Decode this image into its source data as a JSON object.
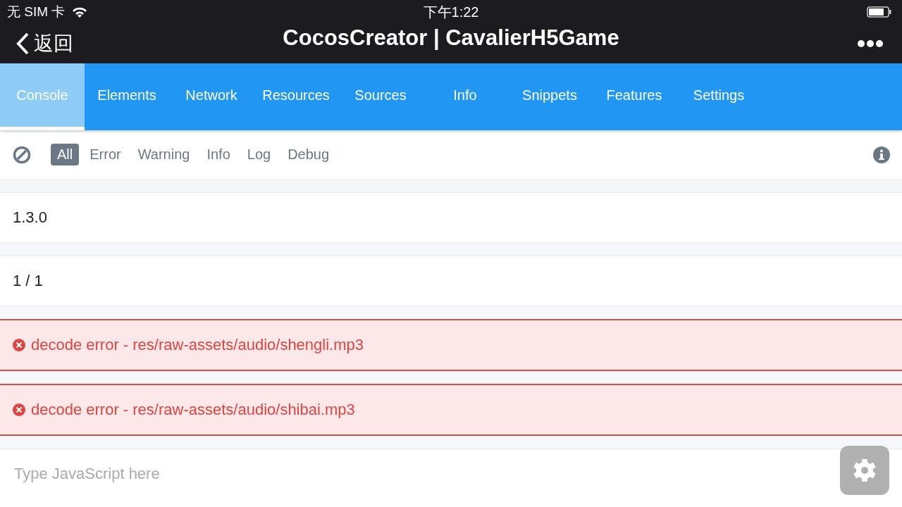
{
  "status_bar": {
    "carrier": "无 SIM 卡",
    "time": "下午1:22"
  },
  "nav": {
    "back": "返回",
    "title": "CocosCreator | CavalierH5Game"
  },
  "tabs": [
    {
      "label": "Console",
      "selected": true
    },
    {
      "label": "Elements",
      "selected": false
    },
    {
      "label": "Network",
      "selected": false
    },
    {
      "label": "Resources",
      "selected": false
    },
    {
      "label": "Sources",
      "selected": false
    },
    {
      "label": "Info",
      "selected": false
    },
    {
      "label": "Snippets",
      "selected": false
    },
    {
      "label": "Features",
      "selected": false
    },
    {
      "label": "Settings",
      "selected": false
    }
  ],
  "filters": [
    {
      "label": "All",
      "selected": true
    },
    {
      "label": "Error",
      "selected": false
    },
    {
      "label": "Warning",
      "selected": false
    },
    {
      "label": "Info",
      "selected": false
    },
    {
      "label": "Log",
      "selected": false
    },
    {
      "label": "Debug",
      "selected": false
    }
  ],
  "logs": [
    {
      "kind": "log",
      "text": "1.3.0"
    },
    {
      "kind": "log",
      "text": "1 / 1"
    },
    {
      "kind": "error",
      "text": "decode error - res/raw-assets/audio/shengli.mp3"
    },
    {
      "kind": "error",
      "text": "decode error - res/raw-assets/audio/shibai.mp3"
    }
  ],
  "input": {
    "placeholder": "Type JavaScript here"
  }
}
